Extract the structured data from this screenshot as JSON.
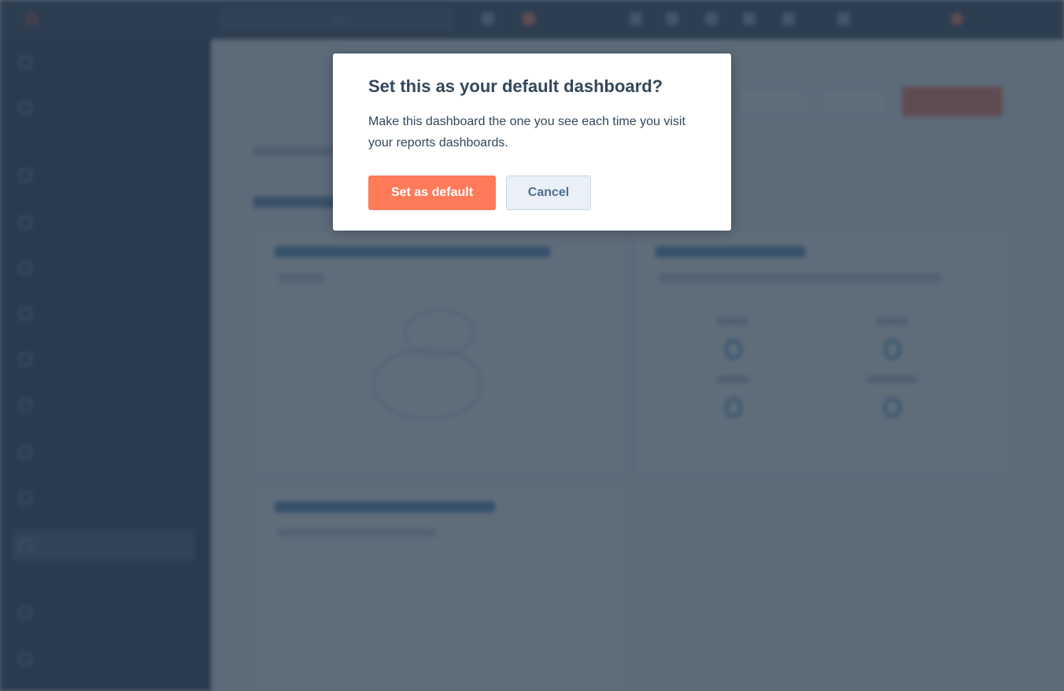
{
  "modal": {
    "title": "Set this as your default dashboard?",
    "body": "Make this dashboard the one you see each time you visit your reports dashboards.",
    "primary_label": "Set as default",
    "secondary_label": "Cancel"
  },
  "colors": {
    "primary": "#ff7a59",
    "secondary_bg": "#eaf0f6",
    "text": "#33475b",
    "nav_bg": "#213343",
    "topbar_bg": "#2d3e50"
  }
}
